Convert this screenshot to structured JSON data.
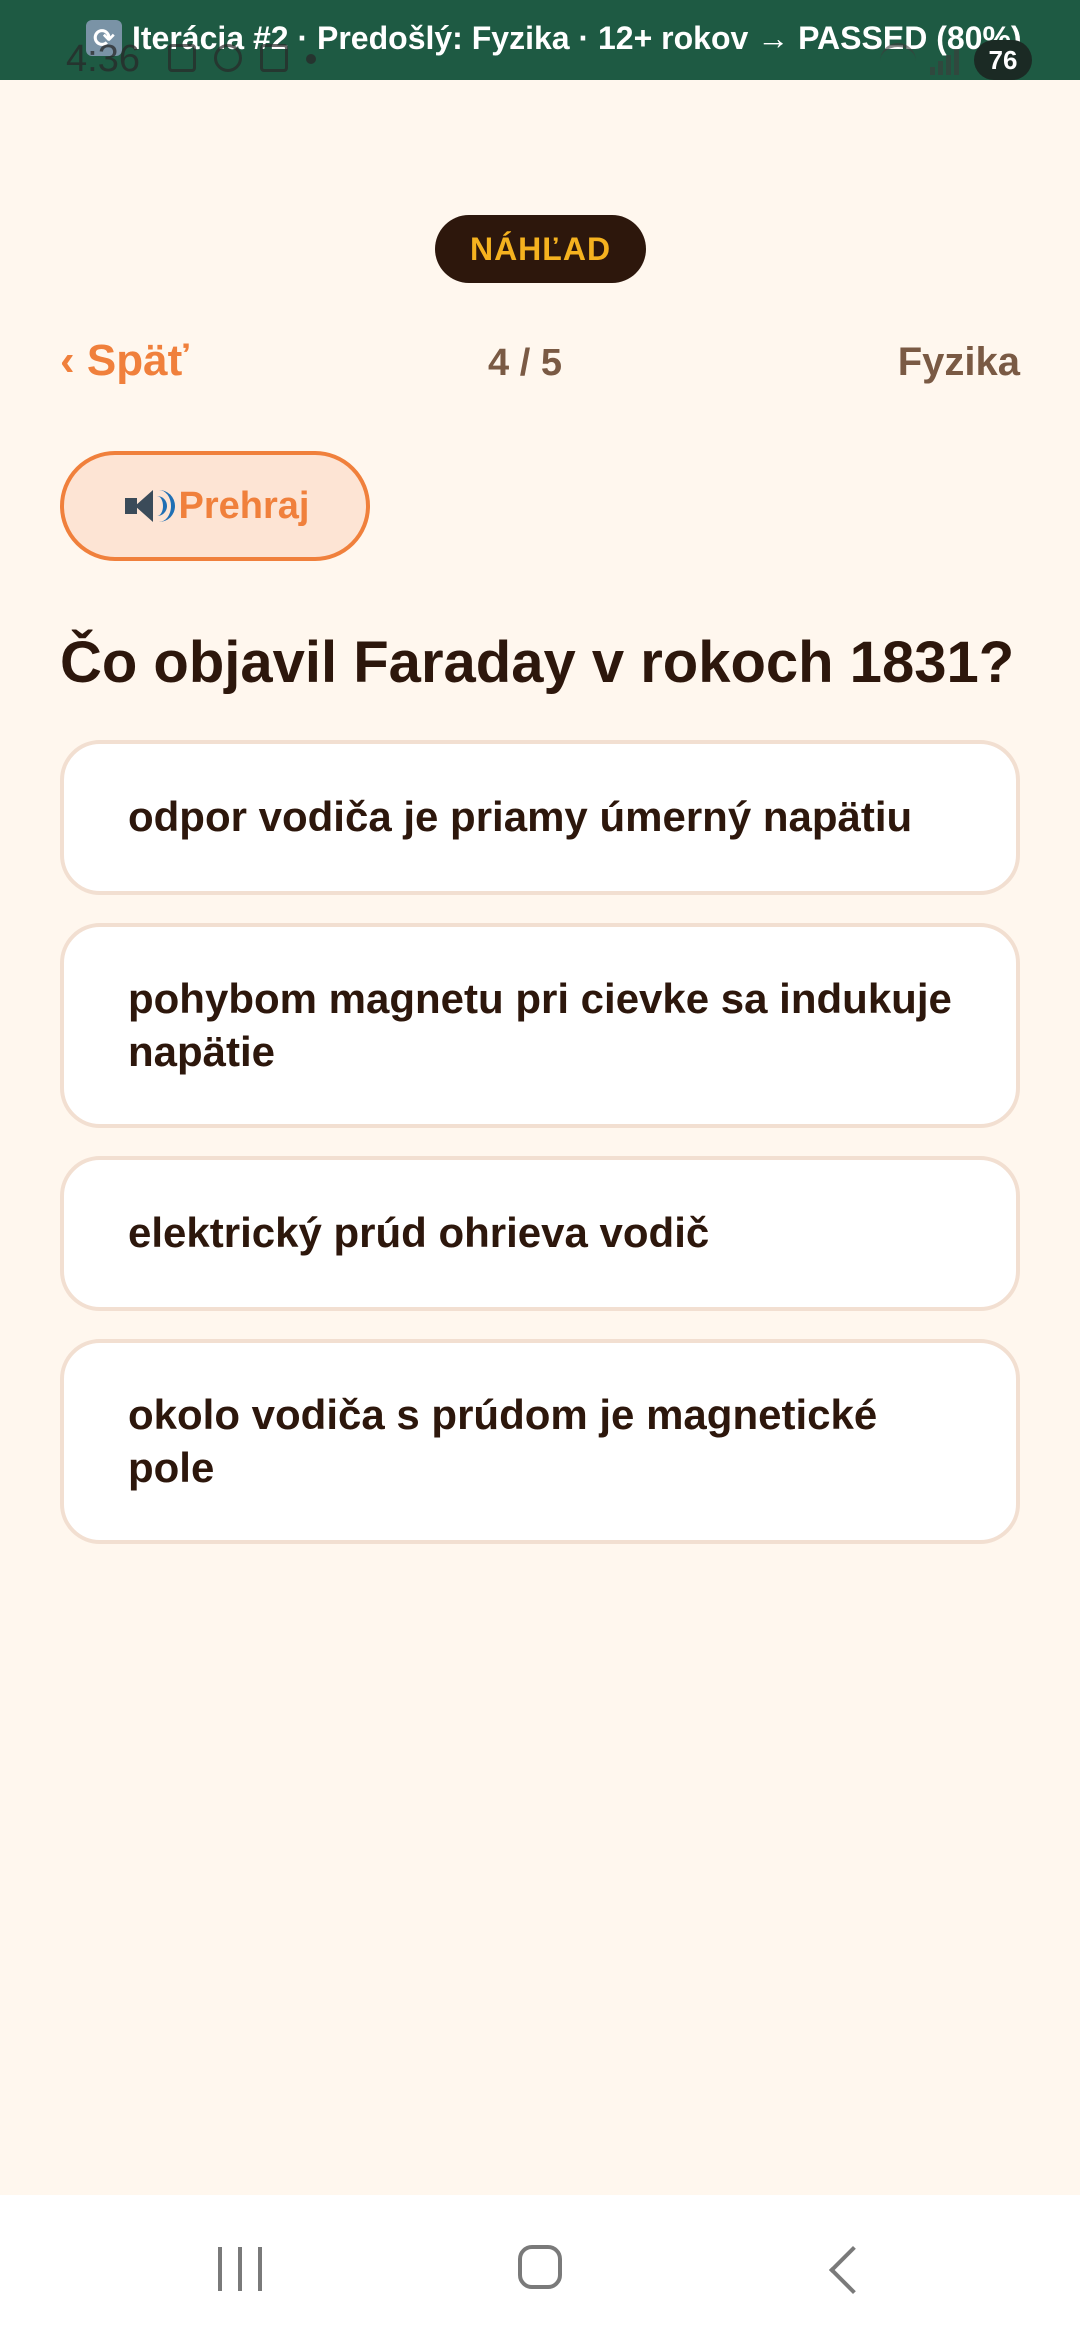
{
  "banner": {
    "icon": "refresh-icon",
    "text": "Iterácia #2 · Predošlý: Fyzika · 12+ rokov → PASSED (80%)"
  },
  "status_bar": {
    "time": "4:36",
    "battery": "76"
  },
  "preview_badge": "NÁHĽAD",
  "header": {
    "back_label": "‹ Späť",
    "progress": "4 / 5",
    "subject": "Fyzika"
  },
  "play_button": {
    "label": "Prehraj",
    "icon": "speaker-icon"
  },
  "question": {
    "text": "Čo objavil Faraday v rokoch 1831?"
  },
  "answers": [
    {
      "text": "odpor vodiča je priamy úmerný napätiu"
    },
    {
      "text": "pohybom magnetu pri cievke sa indukuje napätie"
    },
    {
      "text": "elektrický prúd ohrieva vodič"
    },
    {
      "text": "okolo vodiča s prúdom je magnetické pole"
    }
  ],
  "colors": {
    "banner": "#1e5a43",
    "accent": "#f0803c",
    "background": "#fff7ee",
    "badge_text": "#f5b21f",
    "text_dark": "#2d170c"
  }
}
